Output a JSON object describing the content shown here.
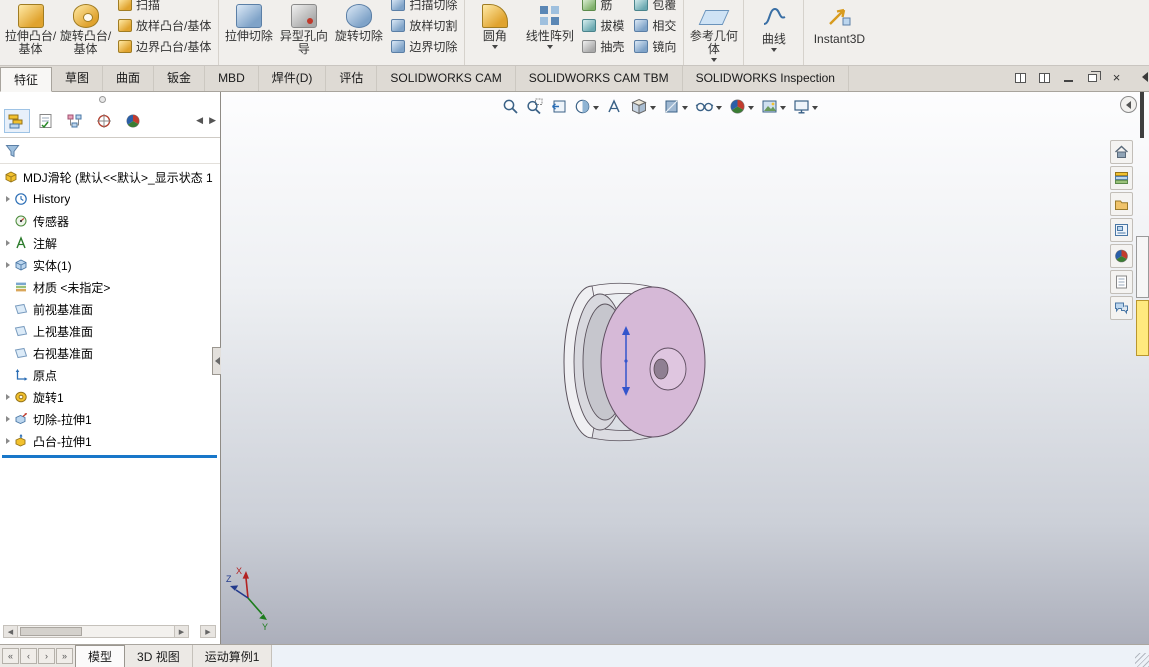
{
  "colors": {
    "model_pink": "#d6b9d7",
    "rollback_blue": "#1877c9",
    "viewport_gradient_top": "#fdfdfe",
    "viewport_gradient_bottom": "#acafbb"
  },
  "ribbon": {
    "columns": [
      {
        "type": "large",
        "label": "拉伸凸台/基体",
        "icon": "extruded-boss-icon"
      },
      {
        "type": "large",
        "label": "旋转凸台/基体",
        "icon": "revolved-boss-icon"
      },
      {
        "type": "stack",
        "items": [
          {
            "label": "扫描",
            "icon": "swept-boss-icon"
          },
          {
            "label": "放样凸台/基体",
            "icon": "lofted-boss-icon"
          },
          {
            "label": "边界凸台/基体",
            "icon": "boundary-boss-icon"
          }
        ]
      },
      {
        "type": "large",
        "label": "拉伸切除",
        "icon": "extruded-cut-icon"
      },
      {
        "type": "large",
        "label": "异型孔向导",
        "icon": "hole-wizard-icon"
      },
      {
        "type": "large",
        "label": "旋转切除",
        "icon": "revolved-cut-icon"
      },
      {
        "type": "stack",
        "items": [
          {
            "label": "扫描切除",
            "icon": "swept-cut-icon"
          },
          {
            "label": "放样切割",
            "icon": "lofted-cut-icon"
          },
          {
            "label": "边界切除",
            "icon": "boundary-cut-icon"
          }
        ]
      },
      {
        "type": "large",
        "label": "圆角",
        "icon": "fillet-icon",
        "dropdown": true
      },
      {
        "type": "large",
        "label": "线性阵列",
        "icon": "linear-pattern-icon",
        "dropdown": true
      },
      {
        "type": "stack",
        "items": [
          {
            "label": "筋",
            "icon": "rib-icon"
          },
          {
            "label": "拔模",
            "icon": "draft-icon"
          },
          {
            "label": "抽壳",
            "icon": "shell-icon"
          }
        ]
      },
      {
        "type": "stack",
        "items": [
          {
            "label": "包覆",
            "icon": "wrap-icon"
          },
          {
            "label": "相交",
            "icon": "intersect-icon"
          },
          {
            "label": "镜向",
            "icon": "mirror-icon"
          }
        ]
      },
      {
        "type": "large",
        "label": "参考几何体",
        "icon": "reference-geometry-icon",
        "dropdown": true
      },
      {
        "type": "large",
        "label": "曲线",
        "icon": "curves-icon",
        "dropdown": true
      },
      {
        "type": "large",
        "label": "Instant3D",
        "icon": "instant3d-icon"
      }
    ]
  },
  "command_tabs": {
    "items": [
      "特征",
      "草图",
      "曲面",
      "钣金",
      "MBD",
      "焊件(D)",
      "评估",
      "SOLIDWORKS CAM",
      "SOLIDWORKS CAM TBM",
      "SOLIDWORKS Inspection"
    ],
    "active": "特征"
  },
  "window_controls": {
    "icons": [
      "pane-left",
      "pane-right",
      "minimize",
      "restore",
      "close"
    ]
  },
  "left_panel": {
    "manager_tabs": [
      "featuremanager-design-tree",
      "propertymanager",
      "configurationmanager",
      "dimxpertmanager",
      "displaymanager"
    ],
    "filter_icon": "filter-funnel",
    "tree": {
      "items": [
        {
          "label": "MDJ滑轮 (默认<<默认>_显示状态 1",
          "icon": "part-icon",
          "expandable": false
        },
        {
          "label": "History",
          "icon": "history-icon",
          "expandable": true
        },
        {
          "label": "传感器",
          "icon": "sensors-icon",
          "expandable": false
        },
        {
          "label": "注解",
          "icon": "annotations-icon",
          "expandable": true
        },
        {
          "label": "实体(1)",
          "icon": "solid-bodies-icon",
          "expandable": true
        },
        {
          "label": "材质 <未指定>",
          "icon": "material-icon",
          "expandable": false
        },
        {
          "label": "前视基准面",
          "icon": "plane-icon",
          "expandable": false
        },
        {
          "label": "上视基准面",
          "icon": "plane-icon",
          "expandable": false
        },
        {
          "label": "右视基准面",
          "icon": "plane-icon",
          "expandable": false
        },
        {
          "label": "原点",
          "icon": "origin-icon",
          "expandable": false
        },
        {
          "label": "旋转1",
          "icon": "revolve-feature-icon",
          "expandable": true
        },
        {
          "label": "切除-拉伸1",
          "icon": "cut-extrude-feature-icon",
          "expandable": true
        },
        {
          "label": "凸台-拉伸1",
          "icon": "boss-extrude-feature-icon",
          "expandable": true
        }
      ]
    }
  },
  "headsup_toolbar": {
    "buttons": [
      {
        "icon": "zoom-to-fit",
        "dropdown": false
      },
      {
        "icon": "zoom-to-area",
        "dropdown": false
      },
      {
        "icon": "previous-view",
        "dropdown": false
      },
      {
        "icon": "section-view",
        "dropdown": true
      },
      {
        "icon": "dynamic-annotation-views",
        "dropdown": false
      },
      {
        "icon": "view-orientation",
        "dropdown": true
      },
      {
        "icon": "display-style",
        "dropdown": true
      },
      {
        "icon": "hide-show-items",
        "dropdown": true
      },
      {
        "icon": "edit-appearance",
        "dropdown": true
      },
      {
        "icon": "apply-scene",
        "dropdown": true
      },
      {
        "icon": "view-settings",
        "dropdown": true
      }
    ]
  },
  "task_pane": {
    "icons": [
      "solidworks-resources",
      "design-library",
      "file-explorer",
      "view-palette",
      "appearances-scenes",
      "custom-properties",
      "solidworks-forum"
    ]
  },
  "viewport": {
    "triad": {
      "x": "X",
      "y": "Y",
      "z": "Z"
    }
  },
  "bottom_bar": {
    "tabs": [
      "模型",
      "3D 视图",
      "运动算例1"
    ],
    "active": "模型"
  }
}
